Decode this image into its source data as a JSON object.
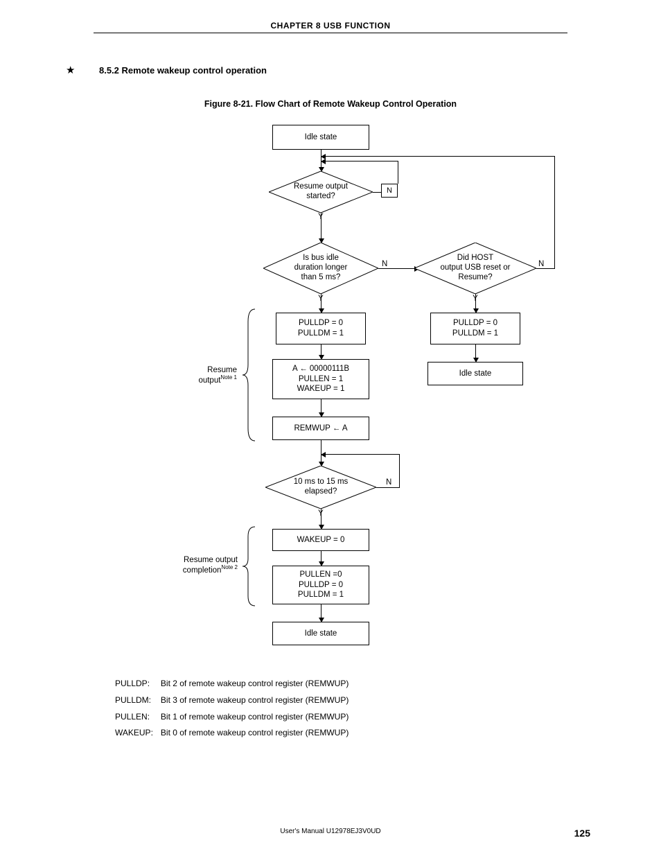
{
  "header": {
    "chapter": "CHAPTER  8   USB  FUNCTION"
  },
  "section": {
    "star": "★",
    "number_title": "8.5.2   Remote wakeup control operation"
  },
  "figure": {
    "title": "Figure 8-21.  Flow Chart of Remote Wakeup Control Operation"
  },
  "nodes": {
    "idle_state_top": "Idle state",
    "resume_started_l1": "Resume output",
    "resume_started_l2": "started?",
    "bus_idle_l1": "Is bus idle",
    "bus_idle_l2": "duration longer",
    "bus_idle_l3": "than 5 ms?",
    "host_reset_l1": "Did HOST",
    "host_reset_l2": "output USB reset or",
    "host_reset_l3": "Resume?",
    "pull_left_l1": "PULLDP = 0",
    "pull_left_l2": "PULLDM = 1",
    "pull_right_l1": "PULLDP = 0",
    "pull_right_l2": "PULLDM = 1",
    "a_assign_l1": "A ← 00000111B",
    "a_assign_l2": "PULLEN = 1",
    "a_assign_l3": "WAKEUP = 1",
    "idle_state_right": "Idle state",
    "remwup_a": "REMWUP ← A",
    "elapsed_l1": "10 ms to 15 ms",
    "elapsed_l2": "elapsed?",
    "wakeup0": "WAKEUP = 0",
    "pullen0_l1": "PULLEN =0",
    "pullen0_l2": "PULLDP = 0",
    "pullen0_l3": "PULLDM = 1",
    "idle_state_bottom": "Idle state",
    "resume_output": "Resume",
    "resume_output2": "output",
    "resume_output_note": "Note 1",
    "resume_complete": "Resume output",
    "resume_complete2": "completion",
    "resume_complete_note": "Note 2",
    "Y": "Y",
    "N": "N"
  },
  "defs": {
    "pulldp_k": "PULLDP:",
    "pulldp_v": "Bit 2 of remote wakeup control register (REMWUP)",
    "pulldm_k": "PULLDM:",
    "pulldm_v": "Bit 3 of remote wakeup control register (REMWUP)",
    "pullen_k": "PULLEN:",
    "pullen_v": "Bit 1 of remote wakeup control register (REMWUP)",
    "wakeup_k": "WAKEUP:",
    "wakeup_v": "Bit 0 of remote wakeup control register (REMWUP)"
  },
  "footer": {
    "manual": "User's Manual  U12978EJ3V0UD",
    "page": "125"
  },
  "chart_data": {
    "type": "flowchart",
    "title": "Flow Chart of Remote Wakeup Control Operation",
    "nodes": [
      {
        "id": "idle_top",
        "kind": "process",
        "text": "Idle state"
      },
      {
        "id": "dec_resume",
        "kind": "decision",
        "text": "Resume output started?"
      },
      {
        "id": "dec_bus",
        "kind": "decision",
        "text": "Is bus idle duration longer than 5 ms?"
      },
      {
        "id": "dec_host",
        "kind": "decision",
        "text": "Did HOST output USB reset or Resume?"
      },
      {
        "id": "pull_l",
        "kind": "process",
        "text": "PULLDP = 0; PULLDM = 1"
      },
      {
        "id": "pull_r",
        "kind": "process",
        "text": "PULLDP = 0; PULLDM = 1"
      },
      {
        "id": "a_assign",
        "kind": "process",
        "text": "A ← 00000111B; PULLEN = 1; WAKEUP = 1"
      },
      {
        "id": "idle_r",
        "kind": "process",
        "text": "Idle state"
      },
      {
        "id": "remwup_a",
        "kind": "process",
        "text": "REMWUP ← A"
      },
      {
        "id": "dec_elapsed",
        "kind": "decision",
        "text": "10 ms to 15 ms elapsed?"
      },
      {
        "id": "wakeup0",
        "kind": "process",
        "text": "WAKEUP = 0"
      },
      {
        "id": "pullen0",
        "kind": "process",
        "text": "PULLEN = 0; PULLDP = 0; PULLDM = 1"
      },
      {
        "id": "idle_b",
        "kind": "process",
        "text": "Idle state"
      }
    ],
    "edges": [
      {
        "from": "idle_top",
        "to": "dec_resume"
      },
      {
        "from": "dec_resume",
        "to": "dec_bus",
        "label": "Y"
      },
      {
        "from": "dec_resume",
        "to": "idle_top",
        "label": "N",
        "note": "loops back"
      },
      {
        "from": "dec_bus",
        "to": "pull_l",
        "label": "Y"
      },
      {
        "from": "dec_bus",
        "to": "dec_host",
        "label": "N"
      },
      {
        "from": "dec_host",
        "to": "pull_r",
        "label": "Y"
      },
      {
        "from": "dec_host",
        "to": "idle_top",
        "label": "N",
        "note": "loops back"
      },
      {
        "from": "pull_l",
        "to": "a_assign"
      },
      {
        "from": "pull_r",
        "to": "idle_r"
      },
      {
        "from": "a_assign",
        "to": "remwup_a"
      },
      {
        "from": "remwup_a",
        "to": "dec_elapsed"
      },
      {
        "from": "dec_elapsed",
        "to": "wakeup0",
        "label": "Y"
      },
      {
        "from": "dec_elapsed",
        "to": "dec_elapsed",
        "label": "N",
        "note": "loops back above"
      },
      {
        "from": "wakeup0",
        "to": "pullen0"
      },
      {
        "from": "pullen0",
        "to": "idle_b"
      }
    ],
    "groups": [
      {
        "label": "Resume output (Note 1)",
        "members": [
          "pull_l",
          "a_assign",
          "remwup_a"
        ]
      },
      {
        "label": "Resume output completion (Note 2)",
        "members": [
          "wakeup0",
          "pullen0"
        ]
      }
    ],
    "legend": {
      "PULLDP": "Bit 2 of remote wakeup control register (REMWUP)",
      "PULLDM": "Bit 3 of remote wakeup control register (REMWUP)",
      "PULLEN": "Bit 1 of remote wakeup control register (REMWUP)",
      "WAKEUP": "Bit 0 of remote wakeup control register (REMWUP)"
    }
  }
}
